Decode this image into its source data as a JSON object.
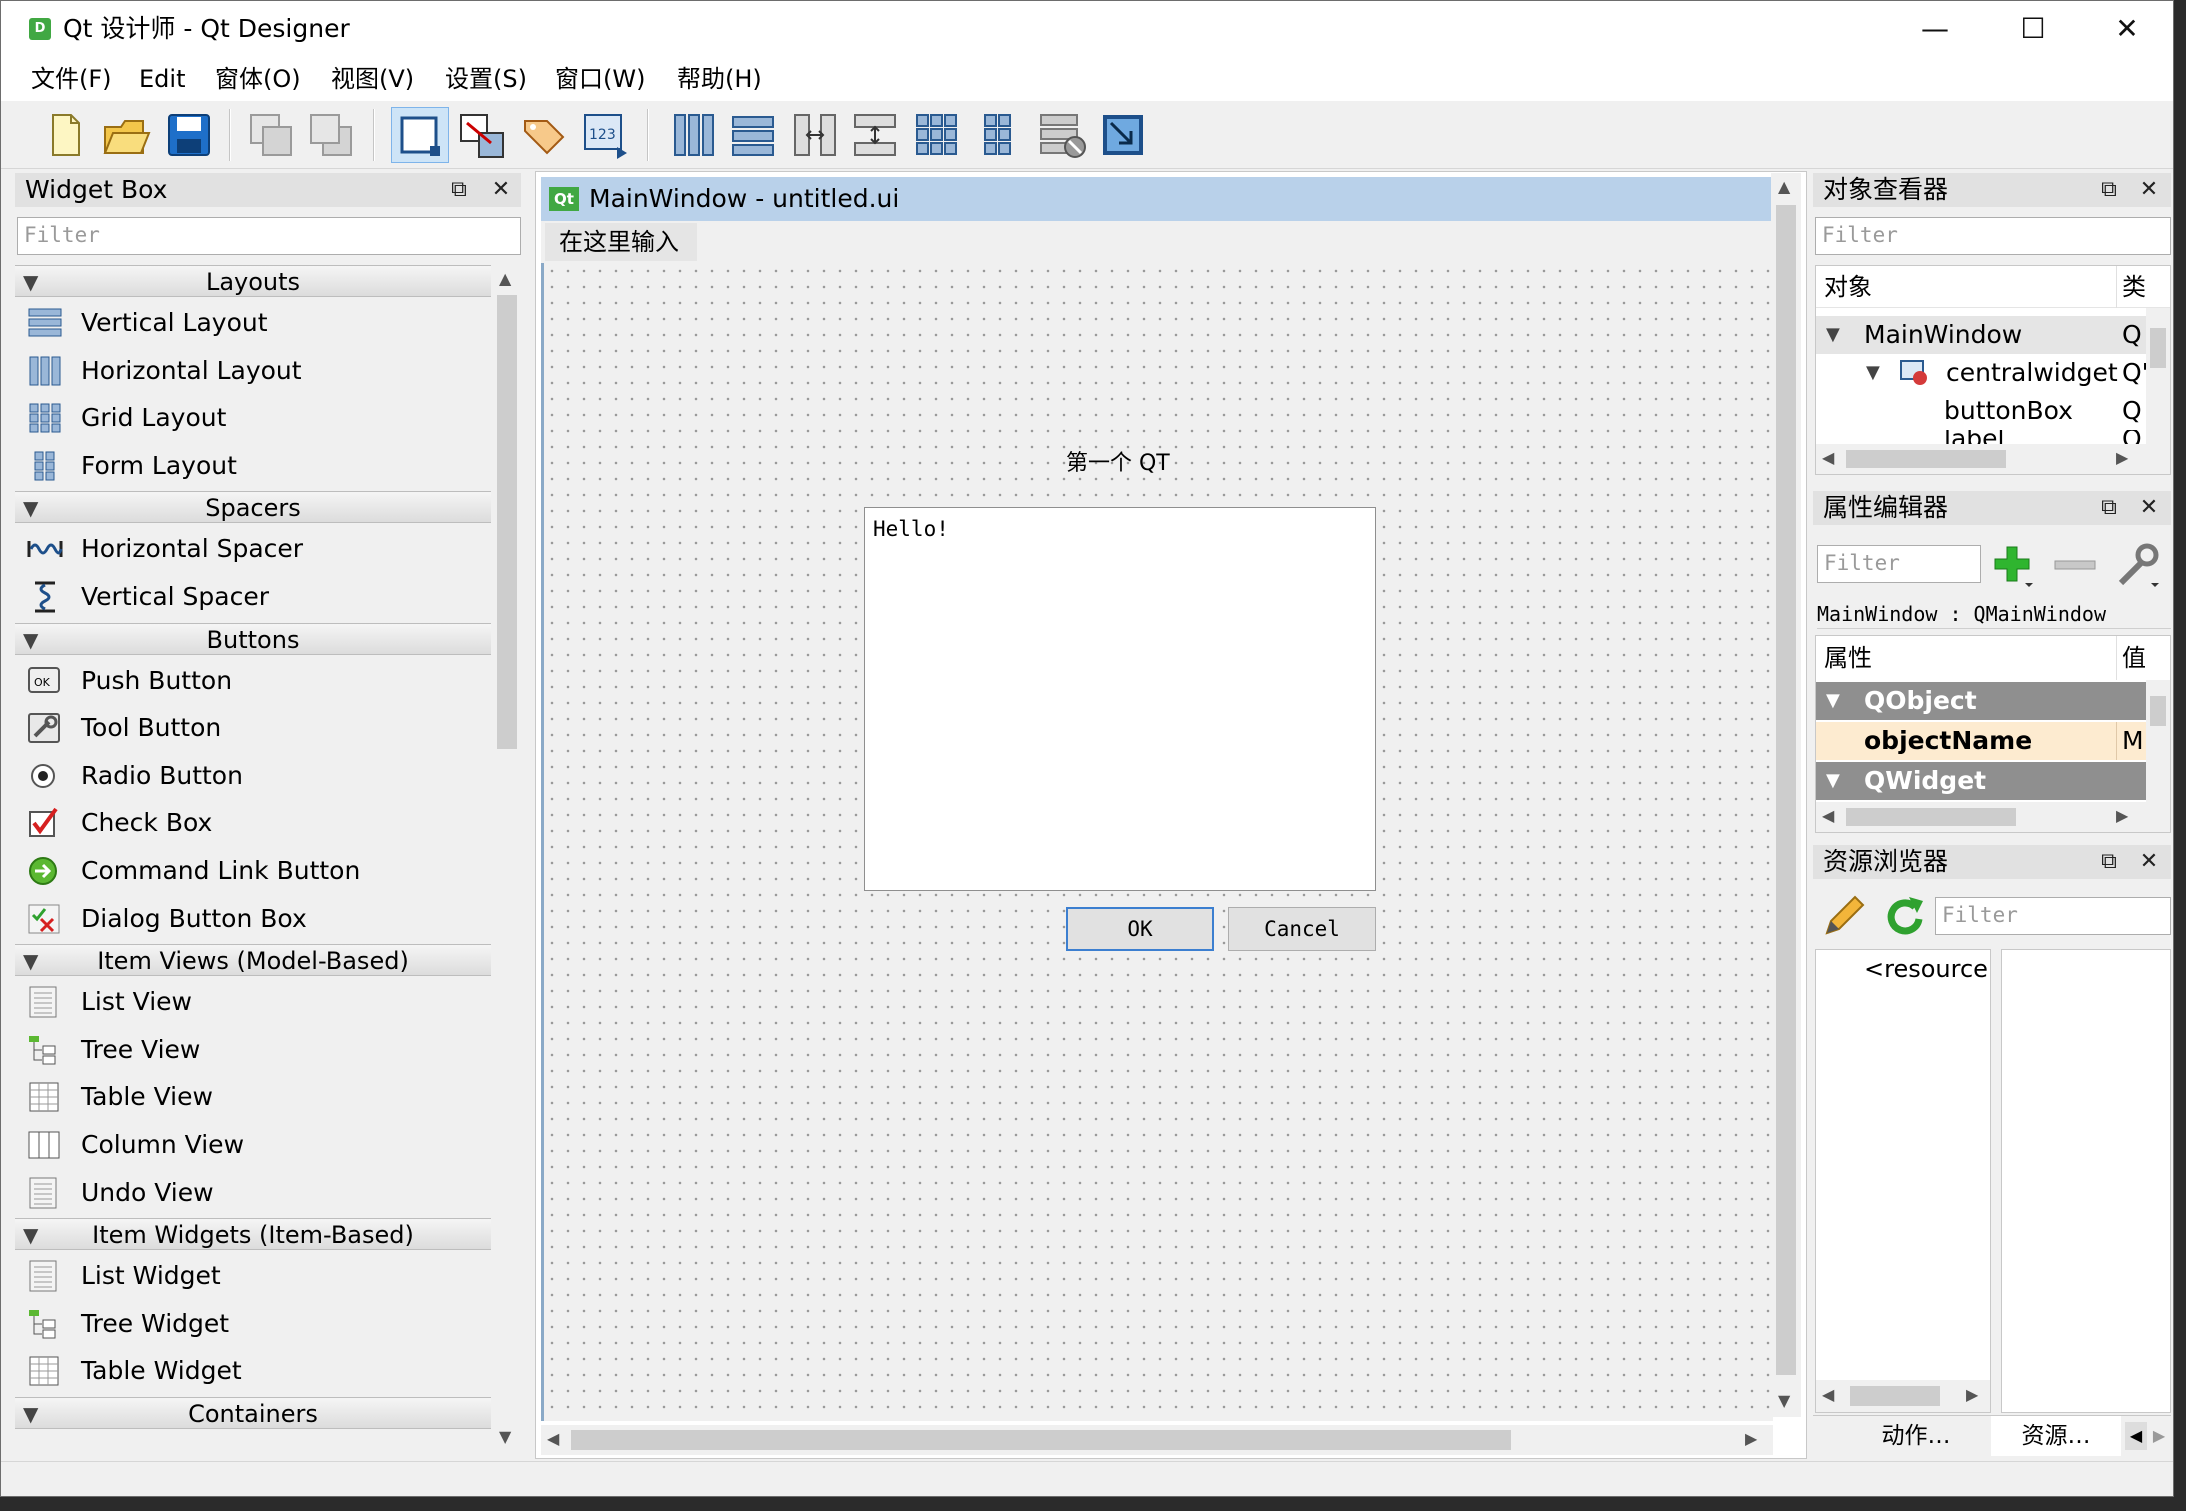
{
  "window": {
    "title": "Qt 设计师 - Qt Designer",
    "icon_letter": "D",
    "minimize": "—",
    "maximize": "☐",
    "close": "✕"
  },
  "menubar": [
    "文件(F)",
    "Edit",
    "窗体(O)",
    "视图(V)",
    "设置(S)",
    "窗口(W)",
    "帮助(H)"
  ],
  "widget_box": {
    "title": "Widget Box",
    "filter_placeholder": "Filter",
    "categories": [
      {
        "name": "Layouts",
        "items": [
          "Vertical Layout",
          "Horizontal Layout",
          "Grid Layout",
          "Form Layout"
        ]
      },
      {
        "name": "Spacers",
        "items": [
          "Horizontal Spacer",
          "Vertical Spacer"
        ]
      },
      {
        "name": "Buttons",
        "items": [
          "Push Button",
          "Tool Button",
          "Radio Button",
          "Check Box",
          "Command Link Button",
          "Dialog Button Box"
        ]
      },
      {
        "name": "Item Views (Model-Based)",
        "items": [
          "List View",
          "Tree View",
          "Table View",
          "Column View",
          "Undo View"
        ]
      },
      {
        "name": "Item Widgets (Item-Based)",
        "items": [
          "List Widget",
          "Tree Widget",
          "Table Widget"
        ]
      },
      {
        "name": "Containers",
        "items": []
      }
    ]
  },
  "form": {
    "title_icon": "Qt",
    "title": "MainWindow - untitled.ui",
    "menu_placeholder": "在这里输入",
    "label_text": "第一个 QT",
    "textedit_text": "Hello!",
    "ok_label": "OK",
    "cancel_label": "Cancel"
  },
  "object_inspector": {
    "title": "对象查看器",
    "filter_placeholder": "Filter",
    "col_object": "对象",
    "col_class": "类",
    "rows": [
      {
        "name": "MainWindow",
        "cls": "Q"
      },
      {
        "name": "centralwidget",
        "cls": "Q'"
      },
      {
        "name": "buttonBox",
        "cls": "Q"
      },
      {
        "name": "label",
        "cls": "Q"
      }
    ]
  },
  "property_editor": {
    "title": "属性编辑器",
    "filter_placeholder": "Filter",
    "object_line": "MainWindow : QMainWindow",
    "col_property": "属性",
    "col_value": "值",
    "rows": [
      {
        "name": "QObject",
        "value": ""
      },
      {
        "name": "objectName",
        "value": "M"
      },
      {
        "name": "QWidget",
        "value": ""
      }
    ]
  },
  "resource_browser": {
    "title": "资源浏览器",
    "filter_placeholder": "Filter",
    "tree_item": "<resource",
    "tabs": [
      "动作…",
      "资源…"
    ]
  },
  "colors": {
    "accent": "#b9d1ea",
    "category_dark": "#8f8f8f",
    "selected_row": "#fdebd0"
  }
}
